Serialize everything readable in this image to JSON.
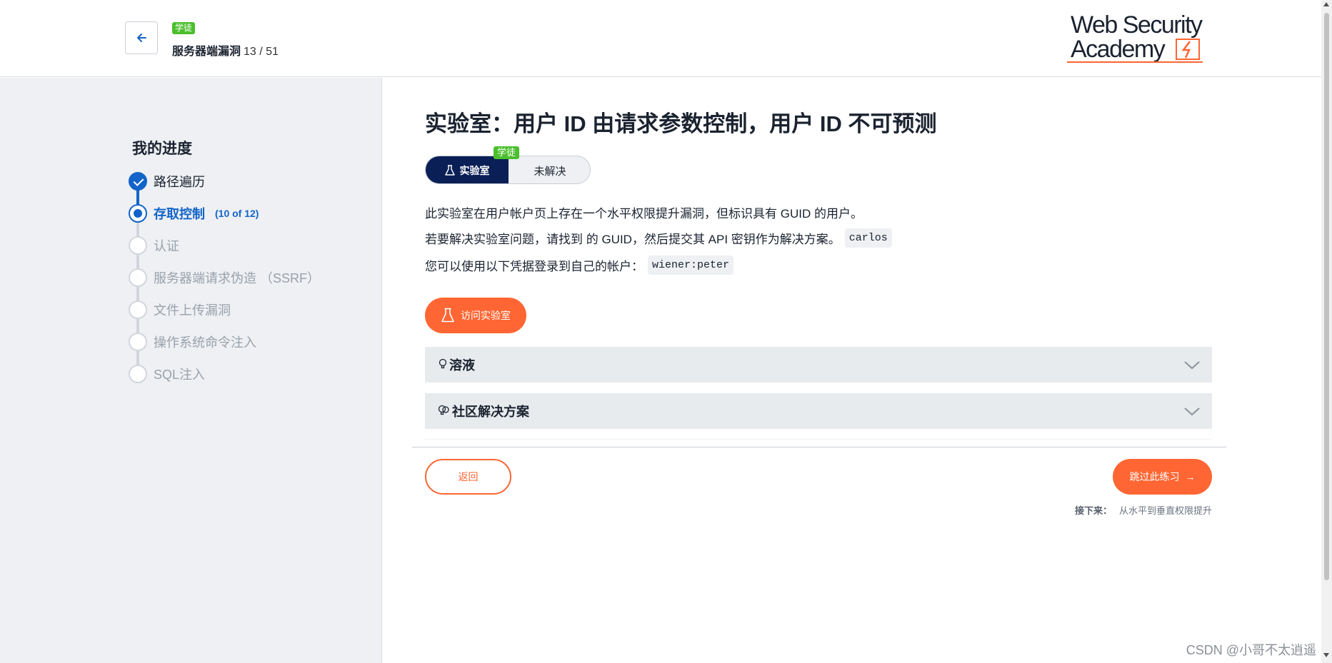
{
  "header": {
    "level_badge": "学徒",
    "topic": "服务器端漏洞",
    "count": "13 / 51",
    "logo_line1": "Web Security",
    "logo_line2": "Academy"
  },
  "sidebar": {
    "title": "我的进度",
    "steps": [
      {
        "label": "路径遍历",
        "state": "done"
      },
      {
        "label": "存取控制",
        "state": "current",
        "sub": "(10 of 12)"
      },
      {
        "label": "认证",
        "state": "todo"
      },
      {
        "label": "服务器端请求伪造 （SSRF）",
        "state": "todo"
      },
      {
        "label": "文件上传漏洞",
        "state": "todo"
      },
      {
        "label": "操作系统命令注入",
        "state": "todo"
      },
      {
        "label": "SQL注入",
        "state": "todo"
      }
    ]
  },
  "main": {
    "title": "实验室：用户 ID 由请求参数控制，用户 ID 不可预测",
    "lab_label": "实验室",
    "status": "未解决",
    "level_badge": "学徒",
    "desc1": "此实验室在用户帐户页上存在一个水平权限提升漏洞，但标识具有 GUID 的用户。",
    "desc2": "若要解决实验室问题，请找到 的 GUID，然后提交其 API 密钥作为解决方案。",
    "desc2_code": "carlos",
    "desc3": "您可以使用以下凭据登录到自己的帐户：",
    "desc3_code": "wiener:peter",
    "access_button": "访问实验室",
    "accordion_solution": "溶液",
    "accordion_community": "社区解决方案",
    "return_button": "返回",
    "skip_button": "跳过此练习",
    "next_label": "接下来：",
    "next_title": "从水平到垂直权限提升"
  },
  "watermark": "CSDN @小哥不太逍遥",
  "colors": {
    "accent": "#ff6633",
    "primary_blue": "#1264c9",
    "lab_navy": "#0a1f56",
    "badge_green": "#4bbf2d"
  }
}
